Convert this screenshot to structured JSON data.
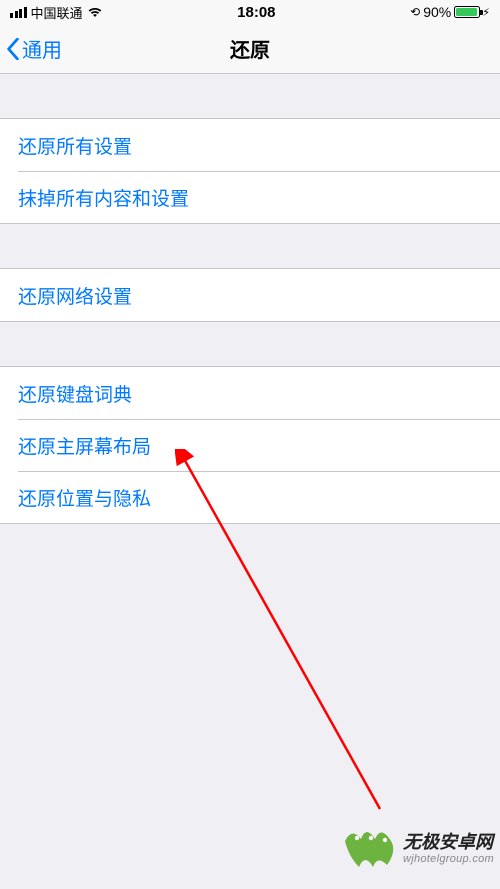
{
  "status": {
    "carrier": "中国联通",
    "time": "18:08",
    "battery_pct": "90%"
  },
  "nav": {
    "back_label": "通用",
    "title": "还原"
  },
  "group1": [
    "还原所有设置",
    "抹掉所有内容和设置"
  ],
  "group2": [
    "还原网络设置"
  ],
  "group3": [
    "还原键盘词典",
    "还原主屏幕布局",
    "还原位置与隐私"
  ],
  "watermark": {
    "title": "无极安卓网",
    "url": "wjhotelgroup.com"
  }
}
